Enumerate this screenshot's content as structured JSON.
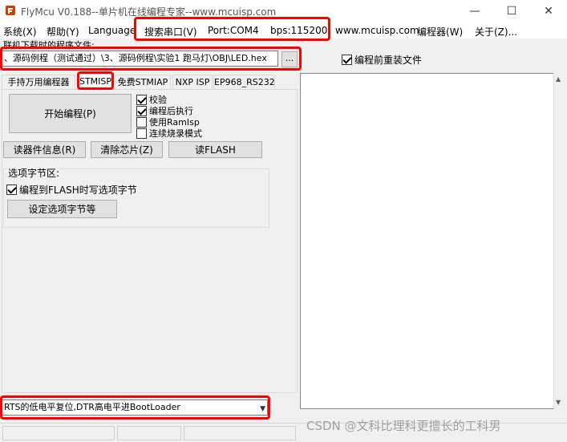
{
  "window": {
    "title": "FlyMcu V0.188--单片机在线编程专家--www.mcuisp.com",
    "minimize": "—",
    "maximize": "☐",
    "close": "✕"
  },
  "menu": {
    "items": [
      "系统(X)",
      "帮助(Y)",
      "Language",
      "搜索串口(V)",
      "Port:COM4",
      "bps:115200",
      "www.mcuisp.com",
      "编程器(W)",
      "关于(Z)..."
    ]
  },
  "file": {
    "label": "联机下载时的程序文件:",
    "path": "、源码例程（测试通过）\\3、源码例程\\实验1 跑马灯\\OBJ\\LED.hex",
    "browse": "..."
  },
  "reload_before_program": {
    "label": "编程前重装文件",
    "checked": true
  },
  "tabs": [
    "手持万用编程器",
    "STMISP",
    "免费STMIAP",
    "NXP ISP",
    "EP968_RS232"
  ],
  "active_tab": "STMISP",
  "stmisp": {
    "start_button": "开始编程(P)",
    "options": [
      {
        "label": "校验",
        "checked": true
      },
      {
        "label": "编程后执行",
        "checked": true
      },
      {
        "label": "使用RamIsp",
        "checked": false
      },
      {
        "label": "连续烧录模式",
        "checked": false
      }
    ],
    "read_info_button": "读器件信息(R)",
    "erase_button": "清除芯片(Z)",
    "read_flash_button": "读FLASH",
    "option_bytes": {
      "title": "选项字节区:",
      "write_option": {
        "label": "编程到FLASH时写选项字节",
        "checked": true
      },
      "set_button": "设定选项字节等"
    }
  },
  "boot_mode": {
    "selected": "RTS的低电平复位,DTR高电平进BootLoader"
  },
  "watermark": "CSDN @文科比理科更擅长的工科男"
}
